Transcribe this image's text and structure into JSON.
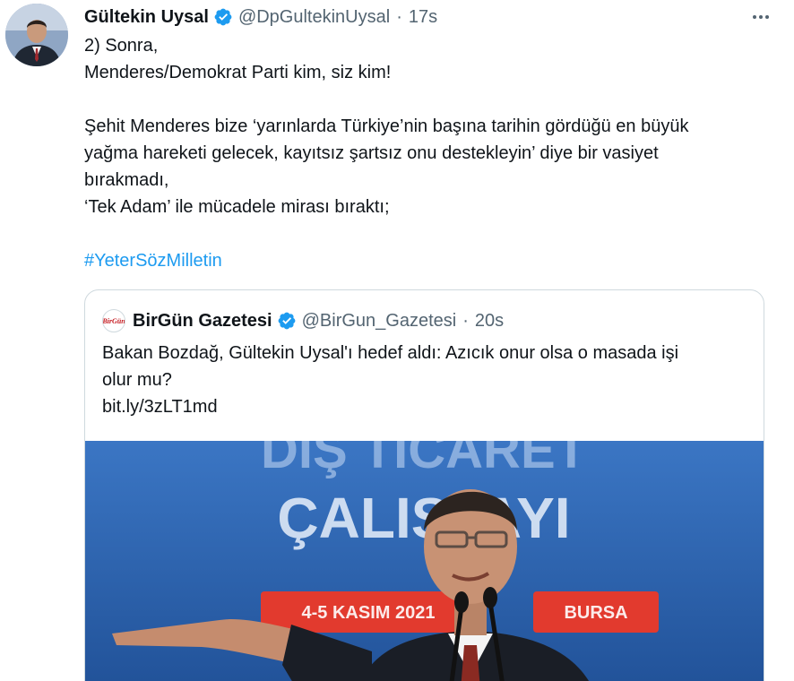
{
  "tweet": {
    "author_name": "Gültekin Uysal",
    "handle": "@DpGultekinUysal",
    "separator": "·",
    "time": "17s",
    "lines": [
      "2) Sonra,",
      "Menderes/Demokrat Parti kim, siz kim!",
      "",
      "Şehit Menderes bize ‘yarınlarda Türkiye’nin başına tarihin gördüğü en büyük",
      "yağma hareketi gelecek, kayıtsız şartsız onu destekleyin’ diye bir vasiyet",
      "bırakmadı,",
      " ‘Tek Adam’ ile mücadele mirası bıraktı;",
      ""
    ],
    "hashtag": "#YeterSözMilletin"
  },
  "quote": {
    "author_name": "BirGün Gazetesi",
    "avatar_text": "BirGün",
    "handle": "@BirGun_Gazetesi",
    "separator": "·",
    "time": "20s",
    "lines": [
      "Bakan Bozdağ, Gültekin Uysal'ı hedef aldı: Azıcık onur olsa o masada işi",
      "olur mu?",
      "bit.ly/3zLT1md"
    ],
    "media": {
      "banner_top": "DIŞ TİCARET",
      "banner_main": "ÇALIŞTAYI",
      "date": "4-5 KASIM 2021",
      "city": "BURSA"
    }
  },
  "colors": {
    "link": "#1d9bf0",
    "text": "#0f1419",
    "muted": "#536471",
    "border": "#cfd9de",
    "verified": "#1d9bf0"
  },
  "icons": {
    "verified": "verified-badge-icon",
    "more": "more-options-icon"
  }
}
